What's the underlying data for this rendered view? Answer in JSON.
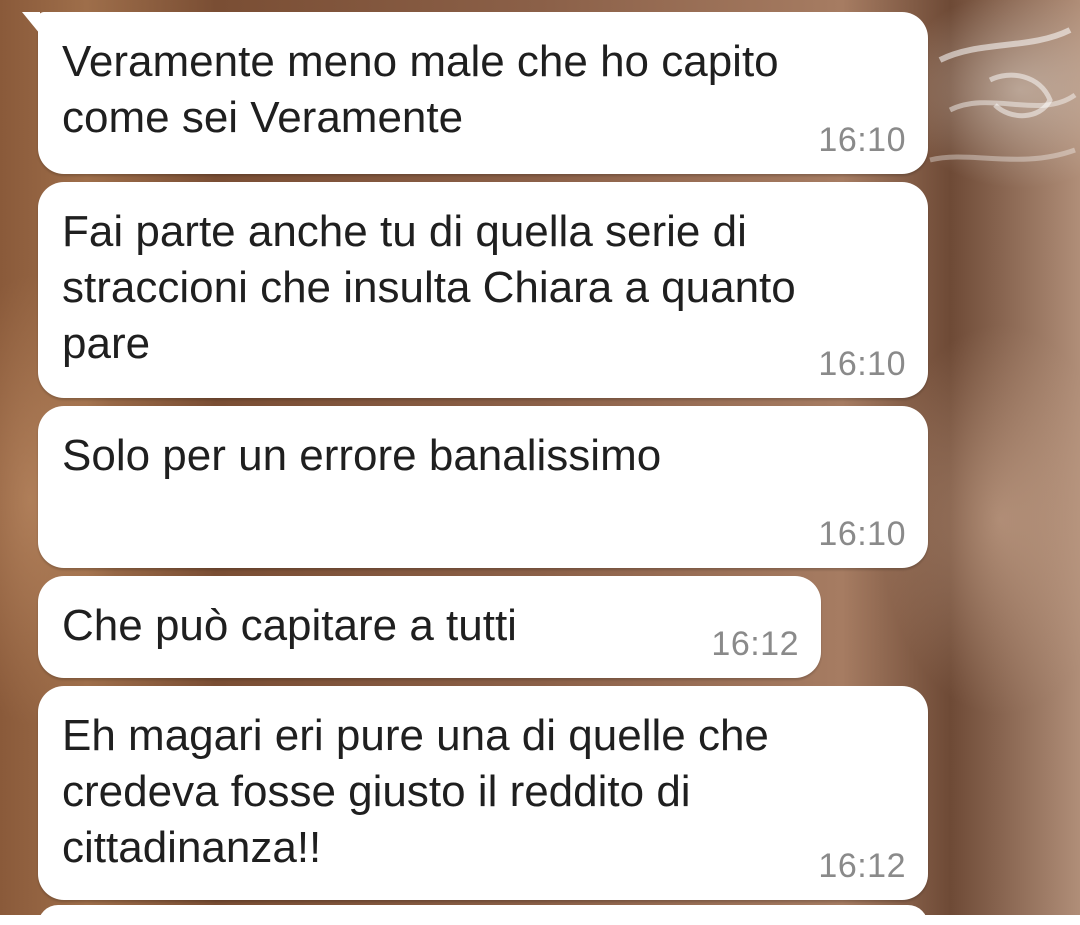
{
  "conversation": {
    "messages": [
      {
        "text": "Veramente meno male che ho capito\ncome sei Veramente",
        "time": "16:10"
      },
      {
        "text": "Fai parte anche tu di quella serie di\nstraccioni che insulta Chiara a quanto\npare",
        "time": "16:10"
      },
      {
        "text": "Solo per un errore banalissimo",
        "time": "16:10"
      },
      {
        "text": "Che può capitare a tutti",
        "time": "16:12"
      },
      {
        "text": "Eh magari eri pure una di quelle che\ncredeva fosse giusto il reddito di\ncittadinanza!!",
        "time": "16:12"
      }
    ]
  },
  "colors": {
    "bubble_background": "#ffffff",
    "message_text": "#1f1f1f",
    "timestamp_text": "#8a8a8a"
  }
}
